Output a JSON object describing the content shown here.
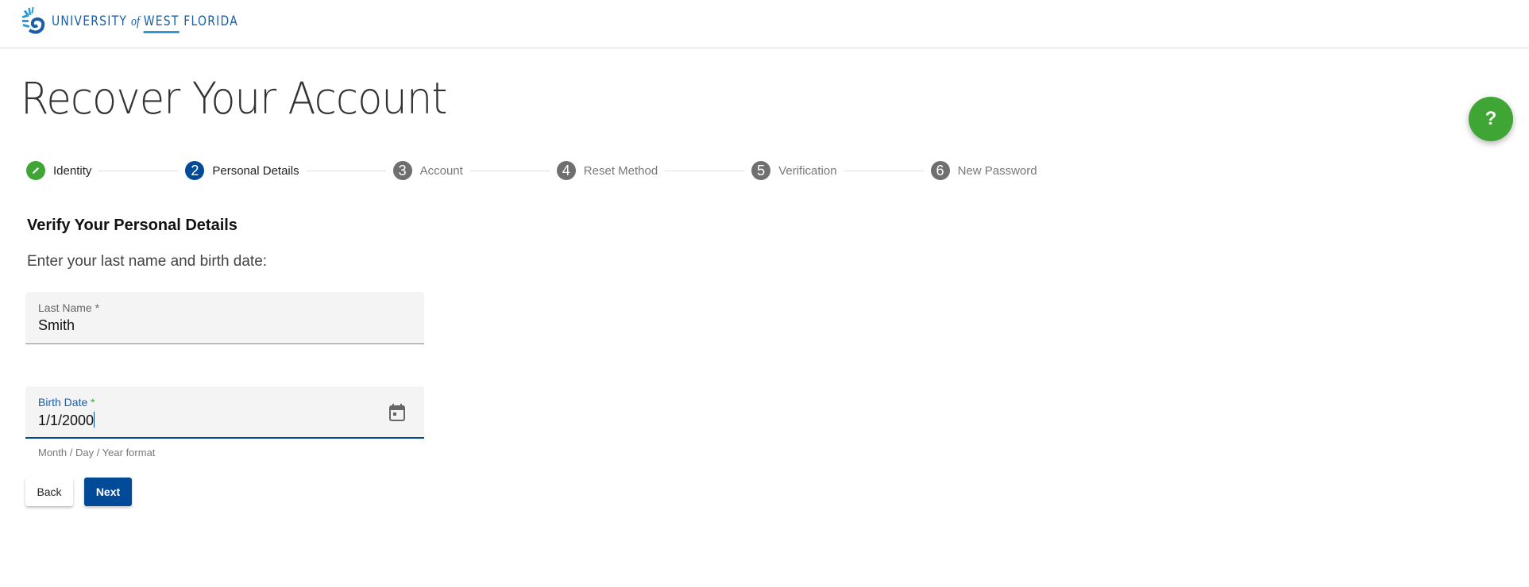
{
  "header": {
    "logo_text": "UNIVERSITY of WEST FLORIDA",
    "logo_parts": [
      "UNIVERSITY",
      "of",
      "WEST",
      "FLORIDA"
    ]
  },
  "page_title": "Recover Your Account",
  "help_button": {
    "label": "?",
    "color": "#3fa535"
  },
  "stepper": {
    "steps": [
      {
        "number": "",
        "label": "Identity",
        "state": "completed",
        "icon": "pencil-icon"
      },
      {
        "number": "2",
        "label": "Personal Details",
        "state": "active"
      },
      {
        "number": "3",
        "label": "Account",
        "state": "pending"
      },
      {
        "number": "4",
        "label": "Reset Method",
        "state": "pending"
      },
      {
        "number": "5",
        "label": "Verification",
        "state": "pending"
      },
      {
        "number": "6",
        "label": "New Password",
        "state": "pending"
      }
    ]
  },
  "form": {
    "section_title": "Verify Your Personal Details",
    "instructions": "Enter your last name and birth date:",
    "last_name": {
      "label": "Last Name",
      "required_mark": "*",
      "value": "Smith"
    },
    "birth_date": {
      "label": "Birth Date",
      "required_mark": "*",
      "value": "1/1/2000",
      "hint": "Month / Day / Year format",
      "icon": "calendar-icon"
    },
    "back_label": "Back",
    "next_label": "Next"
  },
  "colors": {
    "primary": "#004a98",
    "success": "#3fa535",
    "logo": "#1a5ea8"
  }
}
